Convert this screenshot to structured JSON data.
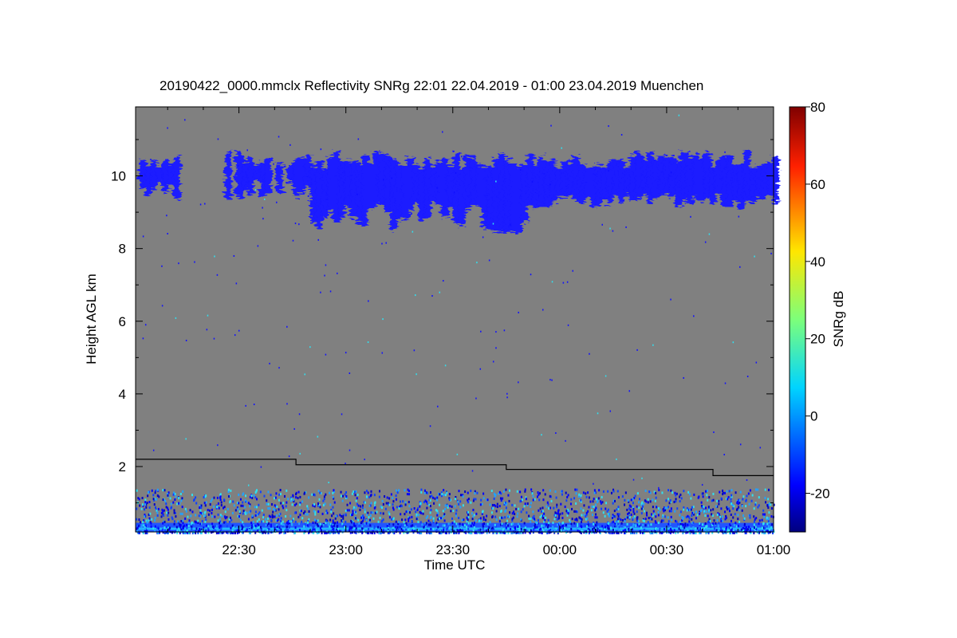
{
  "chart_data": {
    "type": "heatmap",
    "title": "20190422_0000.mmclx Reflectivity SNRg   22:01 22.04.2019 - 01:00 23.04.2019 Muenchen",
    "xlabel": "Time UTC",
    "ylabel": "Height AGL km",
    "x_ticks": [
      "22:30",
      "23:00",
      "23:30",
      "00:00",
      "00:30",
      "01:00"
    ],
    "x_tick_minutes": [
      30,
      60,
      90,
      120,
      150,
      180
    ],
    "xlim_minutes": [
      1,
      180
    ],
    "y_ticks": [
      "2",
      "4",
      "6",
      "8",
      "10"
    ],
    "y_tick_values": [
      2,
      4,
      6,
      8,
      10
    ],
    "ylim": [
      0.2,
      11.9
    ],
    "colorbar": {
      "label": "SNRg dB",
      "ticks": [
        "-20",
        "0",
        "20",
        "40",
        "60",
        "80"
      ],
      "tick_values": [
        -20,
        0,
        20,
        40,
        60,
        80
      ],
      "range": [
        -30,
        80
      ]
    },
    "background_color": "#808080",
    "line_series": {
      "name": "",
      "color": "#000000",
      "points": [
        [
          1,
          2.2
        ],
        [
          46,
          2.2
        ],
        [
          46,
          2.05
        ],
        [
          105,
          2.05
        ],
        [
          105,
          1.92
        ],
        [
          163,
          1.92
        ],
        [
          163,
          1.75
        ],
        [
          180,
          1.75
        ]
      ]
    },
    "cloud_layer_km": {
      "base": [
        8.5,
        9.3
      ],
      "top": [
        10.2,
        10.7
      ],
      "value_dB": -18
    },
    "ground_clutter_km": [
      0.2,
      1.4
    ]
  }
}
